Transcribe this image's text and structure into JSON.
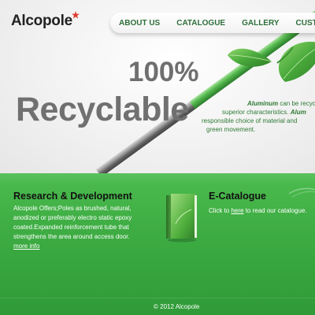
{
  "brand": {
    "name": "Alcopole",
    "star_color": "#e03b2f"
  },
  "nav": {
    "items": [
      {
        "label": "ABOUT US"
      },
      {
        "label": "CATALOGUE"
      },
      {
        "label": "GALLERY"
      },
      {
        "label": "CUSTOM DESIGN"
      }
    ]
  },
  "hero": {
    "headline_top": "100%",
    "headline_main": "Recyclable",
    "text": {
      "line1_bold": "Aluminum",
      "line1_rest": " can be recycled",
      "line2_rest": "superior characteristics. ",
      "line2_bold": "Alum",
      "line3": "responsible choice of material and",
      "line4": "green movement."
    }
  },
  "research": {
    "title": "Research & Development",
    "body": "Alcopole Offers;Poles as brushed, natural, anodized or preferably electro static epoxy coated.Expanded reinforcement tube that strengthens the area around access door.",
    "link": "more info"
  },
  "ecatalogue": {
    "title": "E-Catalogue",
    "body_prefix": "Click to ",
    "link": "here",
    "body_suffix": " to read our catalogue."
  },
  "footer": {
    "text": "© 2012 Alcopole"
  },
  "colors": {
    "accent_green": "#3fae44",
    "nav_text": "#2f6f3a",
    "hero_text_green": "#2e7a34",
    "headline_gray": "#707070"
  },
  "icons": {
    "logo_mark": "star-icon",
    "book": "book-icon",
    "leaf": "leaf-icon",
    "swoosh": "swoosh-icon"
  }
}
